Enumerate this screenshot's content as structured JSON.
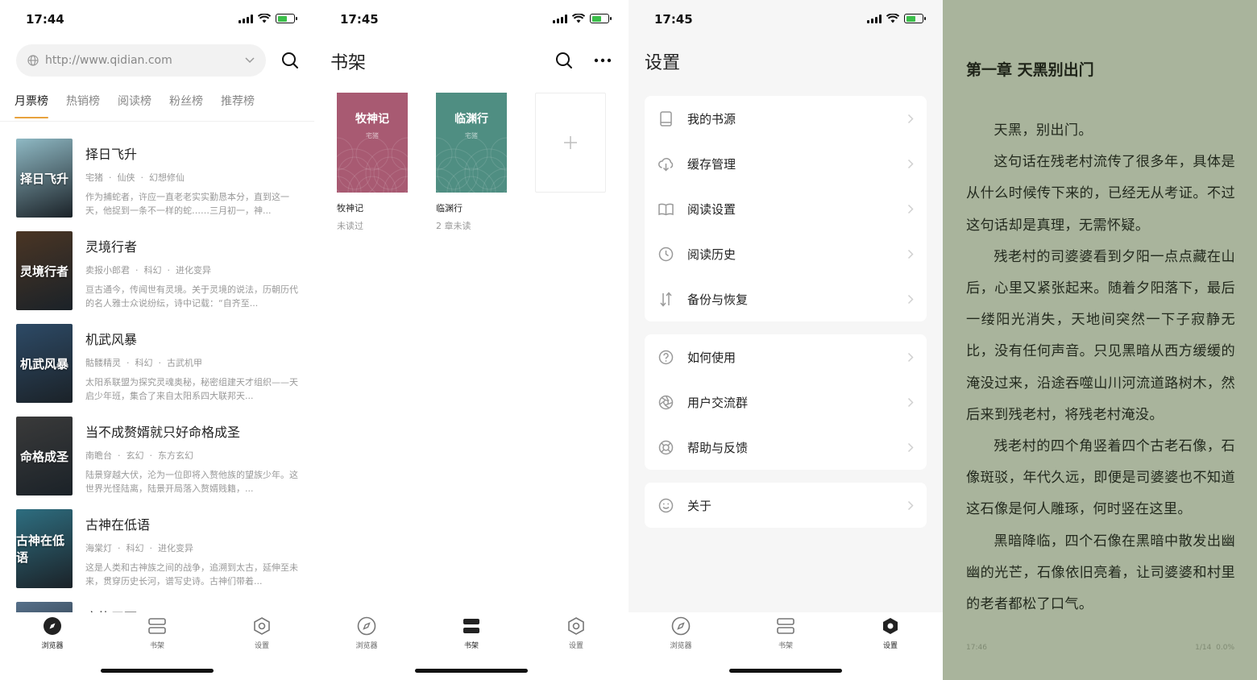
{
  "screens": {
    "browser": {
      "time": "17:44",
      "url": "http://www.qidian.com",
      "tabs": [
        "月票榜",
        "热销榜",
        "阅读榜",
        "粉丝榜",
        "推荐榜"
      ],
      "books": [
        {
          "title": "择日飞升",
          "author": "宅猪",
          "genre": "仙侠",
          "sub": "幻想修仙",
          "desc": "作为捕蛇者，许应一直老老实实勤恳本分，直到这一天，他捉到一条不一样的蛇……三月初一，神...",
          "cover_text": "择日飞升",
          "cover_color": "#8fb9c4"
        },
        {
          "title": "灵境行者",
          "author": "卖报小郎君",
          "genre": "科幻",
          "sub": "进化变异",
          "desc": "亘古通今，传闻世有灵境。关于灵境的说法，历朝历代的名人雅士众说纷纭，诗中记载：“自齐至...",
          "cover_text": "灵境行者",
          "cover_color": "#4a3524"
        },
        {
          "title": "机武风暴",
          "author": "骷髅精灵",
          "genre": "科幻",
          "sub": "古武机甲",
          "desc": "太阳系联盟为探究灵魂奥秘，秘密组建天才组织——天启少年班，集合了来自太阳系四大联邦天...",
          "cover_text": "机武风暴",
          "cover_color": "#2d4a66"
        },
        {
          "title": "当不成赘婿就只好命格成圣",
          "author": "南瞻台",
          "genre": "玄幻",
          "sub": "东方玄幻",
          "desc": "陆景穿越大伏，沦为一位即将入赘他族的望族少年。这世界光怪陆离，陆景开局落入赘婿贱籍，...",
          "cover_text": "命格成圣",
          "cover_color": "#3a3a3a"
        },
        {
          "title": "古神在低语",
          "author": "海棠灯",
          "genre": "科幻",
          "sub": "进化变异",
          "desc": "这是人类和古神族之间的战争，追溯到太古，延伸至未来，贯穿历史长河，谱写史诗。古神们带着...",
          "cover_text": "古神在低语",
          "cover_color": "#2e6e80"
        },
        {
          "title": "宰执天下",
          "author": "",
          "genre": "",
          "sub": "",
          "desc": "",
          "cover_text": "",
          "cover_color": "#56708a"
        }
      ]
    },
    "shelf": {
      "time": "17:45",
      "title": "书架",
      "books": [
        {
          "cover_title": "牧神记",
          "cover_author": "宅猪",
          "name": "牧神记",
          "status": "未读过",
          "color": "#a85a72"
        },
        {
          "cover_title": "临渊行",
          "cover_author": "宅猪",
          "name": "临渊行",
          "status": "2 章未读",
          "color": "#4f8e82"
        }
      ],
      "add_label": "+"
    },
    "settings": {
      "time": "17:45",
      "title": "设置",
      "group1": [
        {
          "label": "我的书源",
          "icon": "book-icon"
        },
        {
          "label": "缓存管理",
          "icon": "cloud-download-icon"
        },
        {
          "label": "阅读设置",
          "icon": "open-book-icon"
        },
        {
          "label": "阅读历史",
          "icon": "clock-icon"
        },
        {
          "label": "备份与恢复",
          "icon": "sort-arrows-icon"
        }
      ],
      "group2": [
        {
          "label": "如何使用",
          "icon": "question-icon"
        },
        {
          "label": "用户交流群",
          "icon": "aperture-icon"
        },
        {
          "label": "帮助与反馈",
          "icon": "lifebuoy-icon"
        }
      ],
      "group3": [
        {
          "label": "关于",
          "icon": "smile-icon"
        }
      ]
    },
    "reader": {
      "chapter": "第一章 天黑别出门",
      "paragraphs": [
        "天黑，别出门。",
        "这句话在残老村流传了很多年，具体是从什么时候传下来的，已经无从考证。不过这句话却是真理，无需怀疑。",
        "残老村的司婆婆看到夕阳一点点藏在山后，心里又紧张起来。随着夕阳落下，最后一缕阳光消失，天地间突然一下子寂静无比，没有任何声音。只见黑暗从西方缓缓的淹没过来，沿途吞噬山川河流道路树木，然后来到残老村，将残老村淹没。",
        "残老村的四个角竖着四个古老石像，石像斑驳，年代久远，即便是司婆婆也不知道这石像是何人雕琢，何时竖在这里。",
        "黑暗降临，四个石像在黑暗中散发出幽幽的光芒，石像依旧亮着，让司婆婆和村里的老者都松了口气。"
      ],
      "footer_time": "17:46",
      "footer_page": "1/14",
      "footer_percent": "0.0%"
    }
  },
  "tabbar": {
    "browser": "浏览器",
    "shelf": "书架",
    "settings": "设置"
  },
  "colors": {
    "accent": "#e8a23d",
    "reader_bg": "#a9b49c",
    "settings_bg": "#f6f6f6"
  }
}
